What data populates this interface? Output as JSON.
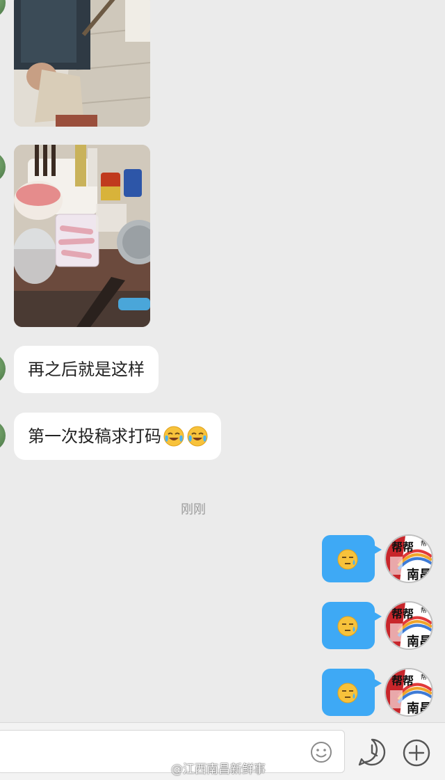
{
  "messages": {
    "incoming_text_1": "再之后就是这样",
    "incoming_text_2": "第一次投稿求打码",
    "timestamp": "刚刚"
  },
  "self_avatar": {
    "text_top": "帮帮",
    "text_small": "帮",
    "text_bottom": "南昌"
  },
  "watermark": "@江西南昌新鲜事",
  "colors": {
    "background": "#ebebeb",
    "outgoing_bubble": "#3ea9f5",
    "incoming_bubble": "#ffffff",
    "avatar_red": "#c8262b"
  },
  "icons": [
    "emoji-icon",
    "clock-icon",
    "plus-icon"
  ]
}
